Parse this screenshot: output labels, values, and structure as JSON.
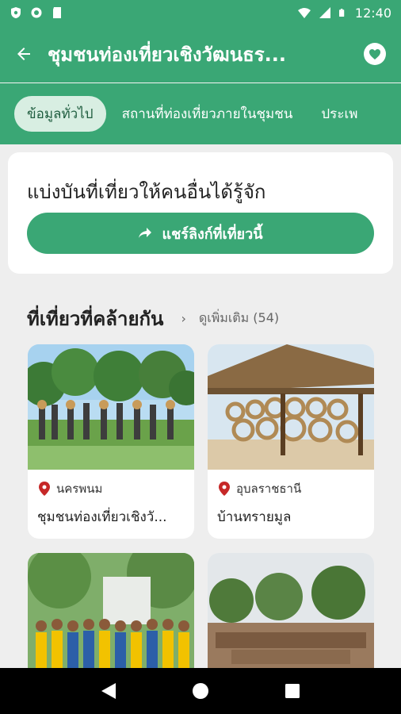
{
  "status_bar": {
    "time": "12:40"
  },
  "app_bar": {
    "title": "ชุมชนท่องเที่ยวเชิงวัฒนธร..."
  },
  "tabs": [
    {
      "label": "ข้อมูลทั่วไป"
    },
    {
      "label": "สถานที่ท่องเที่ยวภายในชุมชน"
    },
    {
      "label": "ประเพ"
    }
  ],
  "share": {
    "title": "แบ่งบันที่เที่ยวให้คนอื่นได้รู้จัก",
    "button_label": "แชร์ลิงก์ที่เที่ยวนี้"
  },
  "similar": {
    "title": "ที่เที่ยวที่คล้ายกัน",
    "more_label": "ดูเพิ่มเติม (54)",
    "cards": [
      {
        "province": "นครพนม",
        "name": "ชุมชนท่องเที่ยวเชิงวั..."
      },
      {
        "province": "อุบลราชธานี",
        "name": "บ้านทรายมูล"
      },
      {
        "province": "",
        "name": ""
      },
      {
        "province": "",
        "name": ""
      }
    ]
  },
  "colors": {
    "brand": "#3aa775",
    "tab_active_bg": "#d8eee2",
    "pin": "#c62828"
  },
  "icons": [
    "shield-icon",
    "sync-icon",
    "sd-card-icon",
    "wifi-icon",
    "signal-icon",
    "battery-icon",
    "back-arrow-icon",
    "heart-icon",
    "share-arrow-icon",
    "chevron-right-icon",
    "location-pin-icon",
    "nav-back-icon",
    "nav-home-icon",
    "nav-recents-icon"
  ]
}
